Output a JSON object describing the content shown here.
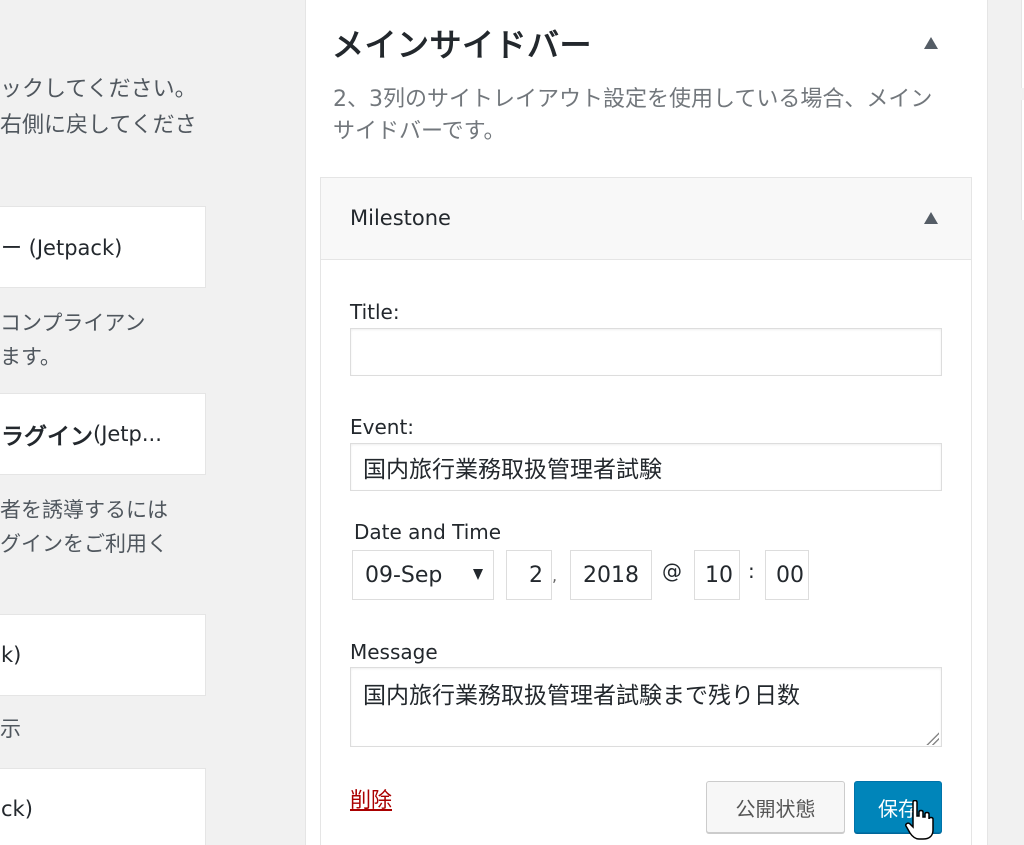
{
  "left": {
    "intro_line1": "ックしてください。",
    "intro_line2": "右側に戻してくださ",
    "widgets": [
      {
        "label": "ー (Jetpack)",
        "desc1": "コンプライアン",
        "desc2": "ます。"
      },
      {
        "label_bold": "ラグイン",
        "label_rest": " (Jetp...",
        "desc1": "者を誘導するには",
        "desc2": "グインをご利用く"
      },
      {
        "label": "k)",
        "desc1": "示"
      },
      {
        "label": "ck)"
      }
    ]
  },
  "sidebar": {
    "title": "メインサイドバー",
    "description": "2、3列のサイトレイアウト設定を使用している場合、メインサイドバーです。"
  },
  "widget": {
    "title": "Milestone",
    "title_label": "Title:",
    "title_value": "",
    "event_label": "Event:",
    "event_value": "国内旅行業務取扱管理者試験",
    "datetime_label": "Date and Time",
    "month": "09-Sep",
    "day": "2",
    "day_sep": ",",
    "year": "2018",
    "at": "@",
    "hour": "10",
    "time_sep": ":",
    "minute": "00",
    "message_label": "Message",
    "message_value": "国内旅行業務取扱管理者試験まで残り日数",
    "delete_label": "削除",
    "status_button": "公開状態",
    "save_button": "保存"
  }
}
